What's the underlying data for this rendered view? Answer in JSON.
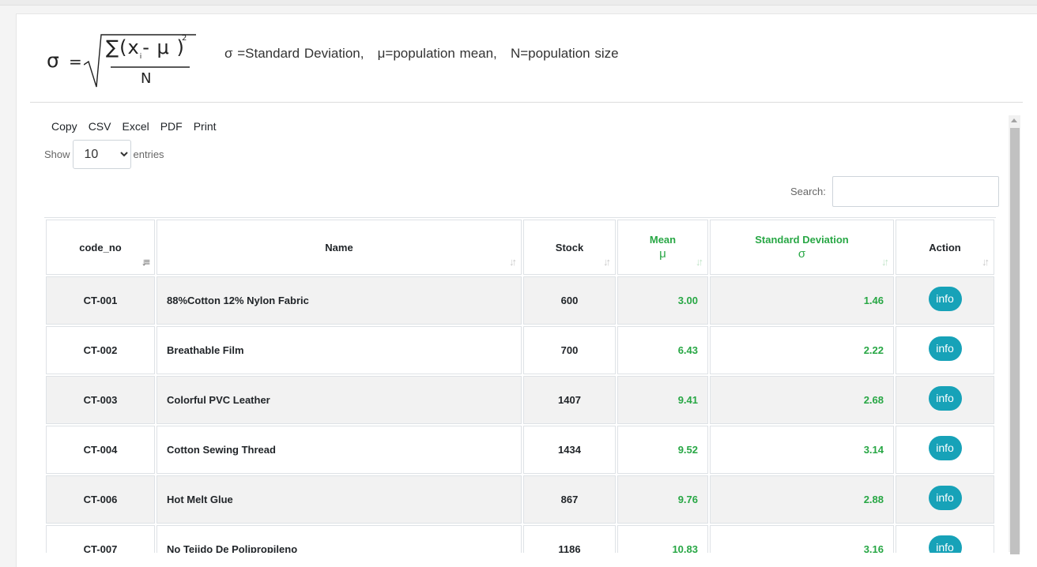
{
  "formula": {
    "sigma": "σ",
    "equals": "=",
    "numerator_open": "∑(x",
    "numerator_sub": "i",
    "numerator_close": "- μ )",
    "power": "2",
    "denominator": "N",
    "legend": "σ =Standard Deviation,   μ=population mean,   N=population size"
  },
  "toolbar": {
    "buttons": [
      "Copy",
      "CSV",
      "Excel",
      "PDF",
      "Print"
    ]
  },
  "length_control": {
    "show_label": "Show",
    "selected": "10",
    "entries_label": "entries"
  },
  "search": {
    "label": "Search:",
    "value": ""
  },
  "table": {
    "headers": [
      {
        "label": "code_no",
        "symbol": ""
      },
      {
        "label": "Name",
        "symbol": ""
      },
      {
        "label": "Stock",
        "symbol": ""
      },
      {
        "label": "Mean",
        "symbol": "μ"
      },
      {
        "label": "Standard Deviation",
        "symbol": "σ"
      },
      {
        "label": "Action",
        "symbol": ""
      }
    ],
    "rows": [
      {
        "code": "CT-001",
        "name": "88%Cotton 12% Nylon Fabric",
        "stock": "600",
        "mean": "3.00",
        "sd": "1.46",
        "action": "info"
      },
      {
        "code": "CT-002",
        "name": "Breathable Film",
        "stock": "700",
        "mean": "6.43",
        "sd": "2.22",
        "action": "info"
      },
      {
        "code": "CT-003",
        "name": "Colorful PVC Leather",
        "stock": "1407",
        "mean": "9.41",
        "sd": "2.68",
        "action": "info"
      },
      {
        "code": "CT-004",
        "name": "Cotton Sewing Thread",
        "stock": "1434",
        "mean": "9.52",
        "sd": "3.14",
        "action": "info"
      },
      {
        "code": "CT-006",
        "name": "Hot Melt Glue",
        "stock": "867",
        "mean": "9.76",
        "sd": "2.88",
        "action": "info"
      },
      {
        "code": "CT-007",
        "name": "No Tejido De Polipropileno",
        "stock": "1186",
        "mean": "10.83",
        "sd": "3.16",
        "action": "info"
      }
    ]
  },
  "colors": {
    "accent_green": "#28a745",
    "info_button": "#17a2b8"
  }
}
